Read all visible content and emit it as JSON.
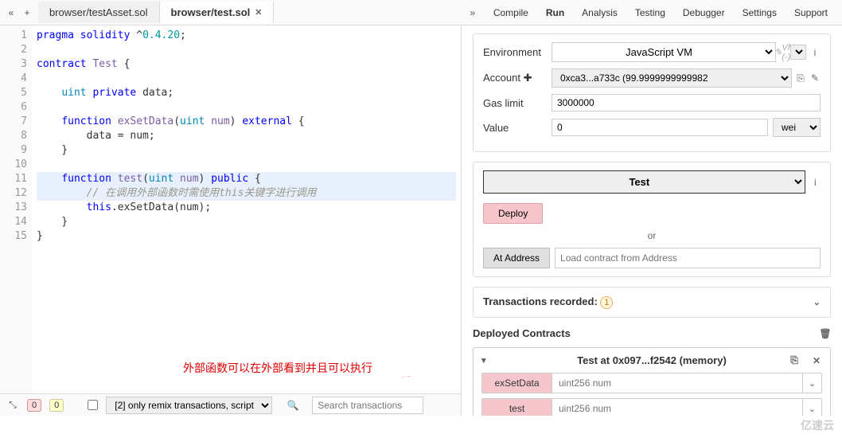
{
  "tabs": [
    {
      "label": "browser/testAsset.sol",
      "active": false
    },
    {
      "label": "browser/test.sol",
      "active": true
    }
  ],
  "nav": {
    "compile": "Compile",
    "run": "Run",
    "analysis": "Analysis",
    "testing": "Testing",
    "debugger": "Debugger",
    "settings": "Settings",
    "support": "Support"
  },
  "code": {
    "lines": [
      {
        "n": 1,
        "tokens": [
          [
            "kw",
            "pragma"
          ],
          [
            "pl",
            " "
          ],
          [
            "kw",
            "solidity"
          ],
          [
            "pl",
            " ^"
          ],
          [
            "num",
            "0.4.20"
          ],
          [
            "pl",
            ";"
          ]
        ]
      },
      {
        "n": 2,
        "tokens": []
      },
      {
        "n": 3,
        "fold": true,
        "tokens": [
          [
            "kw",
            "contract"
          ],
          [
            "pl",
            " "
          ],
          [
            "id",
            "Test"
          ],
          [
            "pl",
            " {"
          ]
        ]
      },
      {
        "n": 4,
        "tokens": []
      },
      {
        "n": 5,
        "tokens": [
          [
            "pl",
            "    "
          ],
          [
            "type",
            "uint"
          ],
          [
            "pl",
            " "
          ],
          [
            "kw",
            "private"
          ],
          [
            "pl",
            " data;"
          ]
        ]
      },
      {
        "n": 6,
        "tokens": []
      },
      {
        "n": 7,
        "fold": true,
        "tokens": [
          [
            "pl",
            "    "
          ],
          [
            "kw",
            "function"
          ],
          [
            "pl",
            " "
          ],
          [
            "id",
            "exSetData"
          ],
          [
            "pl",
            "("
          ],
          [
            "type",
            "uint"
          ],
          [
            "pl",
            " "
          ],
          [
            "id",
            "num"
          ],
          [
            "pl",
            ") "
          ],
          [
            "kw",
            "external"
          ],
          [
            "pl",
            " {"
          ]
        ]
      },
      {
        "n": 8,
        "tokens": [
          [
            "pl",
            "        data = num;"
          ]
        ]
      },
      {
        "n": 9,
        "tokens": [
          [
            "pl",
            "    }"
          ]
        ]
      },
      {
        "n": 10,
        "tokens": []
      },
      {
        "n": 11,
        "fold": true,
        "hl": true,
        "tokens": [
          [
            "pl",
            "    "
          ],
          [
            "kw",
            "function"
          ],
          [
            "pl",
            " "
          ],
          [
            "id",
            "test"
          ],
          [
            "pl",
            "("
          ],
          [
            "type",
            "uint"
          ],
          [
            "pl",
            " "
          ],
          [
            "id",
            "num"
          ],
          [
            "pl",
            ") "
          ],
          [
            "kw",
            "public"
          ],
          [
            "pl",
            " {"
          ]
        ]
      },
      {
        "n": 12,
        "hl": true,
        "tokens": [
          [
            "pl",
            "        "
          ],
          [
            "cmt",
            "// 在调用外部函数时需使用this关键字进行调用"
          ]
        ]
      },
      {
        "n": 13,
        "tokens": [
          [
            "pl",
            "        "
          ],
          [
            "kw",
            "this"
          ],
          [
            "pl",
            ".exSetData(num);"
          ]
        ]
      },
      {
        "n": 14,
        "tokens": [
          [
            "pl",
            "    }"
          ]
        ]
      },
      {
        "n": 15,
        "tokens": [
          [
            "pl",
            "}"
          ]
        ]
      }
    ]
  },
  "annotation": "外部函数可以在外部看到并且可以执行",
  "bottom": {
    "warn_count": "0",
    "err_count": "0",
    "filter_label": "[2] only remix transactions, script",
    "search_placeholder": "Search transactions"
  },
  "run": {
    "env_label": "Environment",
    "env_value": "JavaScript VM",
    "vm_note": "VM (-)",
    "account_label": "Account",
    "account_value": "0xca3...a733c (99.9999999999982",
    "gas_label": "Gas limit",
    "gas_value": "3000000",
    "value_label": "Value",
    "value_amount": "0",
    "value_unit": "wei",
    "contract_name": "Test",
    "deploy_btn": "Deploy",
    "or_label": "or",
    "at_address_btn": "At Address",
    "at_address_placeholder": "Load contract from Address",
    "trans_recorded_label": "Transactions recorded:",
    "trans_count": "1",
    "deployed_label": "Deployed Contracts",
    "instance_title": "Test at 0x097...f2542 (memory)",
    "functions": [
      {
        "name": "exSetData",
        "placeholder": "uint256 num"
      },
      {
        "name": "test",
        "placeholder": "uint256 num"
      }
    ]
  },
  "watermark": "亿速云"
}
